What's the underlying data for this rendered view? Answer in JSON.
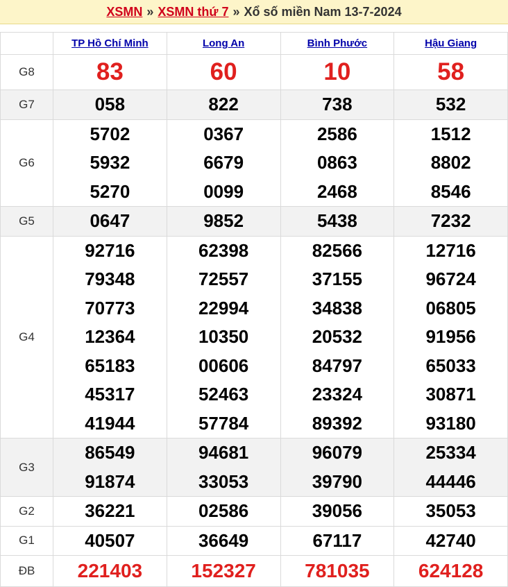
{
  "header": {
    "link1": "XSMN",
    "sep1": "»",
    "link2": "XSMN thứ 7",
    "sep2": "»",
    "title": "Xổ số miền Nam 13-7-2024"
  },
  "provinces": [
    "TP Hồ Chí Minh",
    "Long An",
    "Bình Phước",
    "Hậu Giang"
  ],
  "prizes": {
    "G8": {
      "label": "G8",
      "values": [
        [
          "83"
        ],
        [
          "60"
        ],
        [
          "10"
        ],
        [
          "58"
        ]
      ]
    },
    "G7": {
      "label": "G7",
      "values": [
        [
          "058"
        ],
        [
          "822"
        ],
        [
          "738"
        ],
        [
          "532"
        ]
      ]
    },
    "G6": {
      "label": "G6",
      "values": [
        [
          "5702",
          "5932",
          "5270"
        ],
        [
          "0367",
          "6679",
          "0099"
        ],
        [
          "2586",
          "0863",
          "2468"
        ],
        [
          "1512",
          "8802",
          "8546"
        ]
      ]
    },
    "G5": {
      "label": "G5",
      "values": [
        [
          "0647"
        ],
        [
          "9852"
        ],
        [
          "5438"
        ],
        [
          "7232"
        ]
      ]
    },
    "G4": {
      "label": "G4",
      "values": [
        [
          "92716",
          "79348",
          "70773",
          "12364",
          "65183",
          "45317",
          "41944"
        ],
        [
          "62398",
          "72557",
          "22994",
          "10350",
          "00606",
          "52463",
          "57784"
        ],
        [
          "82566",
          "37155",
          "34838",
          "20532",
          "84797",
          "23324",
          "89392"
        ],
        [
          "12716",
          "96724",
          "06805",
          "91956",
          "65033",
          "30871",
          "93180"
        ]
      ]
    },
    "G3": {
      "label": "G3",
      "values": [
        [
          "86549",
          "91874"
        ],
        [
          "94681",
          "33053"
        ],
        [
          "96079",
          "39790"
        ],
        [
          "25334",
          "44446"
        ]
      ]
    },
    "G2": {
      "label": "G2",
      "values": [
        [
          "36221"
        ],
        [
          "02586"
        ],
        [
          "39056"
        ],
        [
          "35053"
        ]
      ]
    },
    "G1": {
      "label": "G1",
      "values": [
        [
          "40507"
        ],
        [
          "36649"
        ],
        [
          "67117"
        ],
        [
          "42740"
        ]
      ]
    },
    "DB": {
      "label": "ĐB",
      "values": [
        [
          "221403"
        ],
        [
          "152327"
        ],
        [
          "781035"
        ],
        [
          "624128"
        ]
      ]
    }
  },
  "colors": {
    "accent_red": "#e0201e",
    "header_bg": "#fdf5c9",
    "link_blue": "#0000aa",
    "alt_row_bg": "#f2f2f2"
  }
}
